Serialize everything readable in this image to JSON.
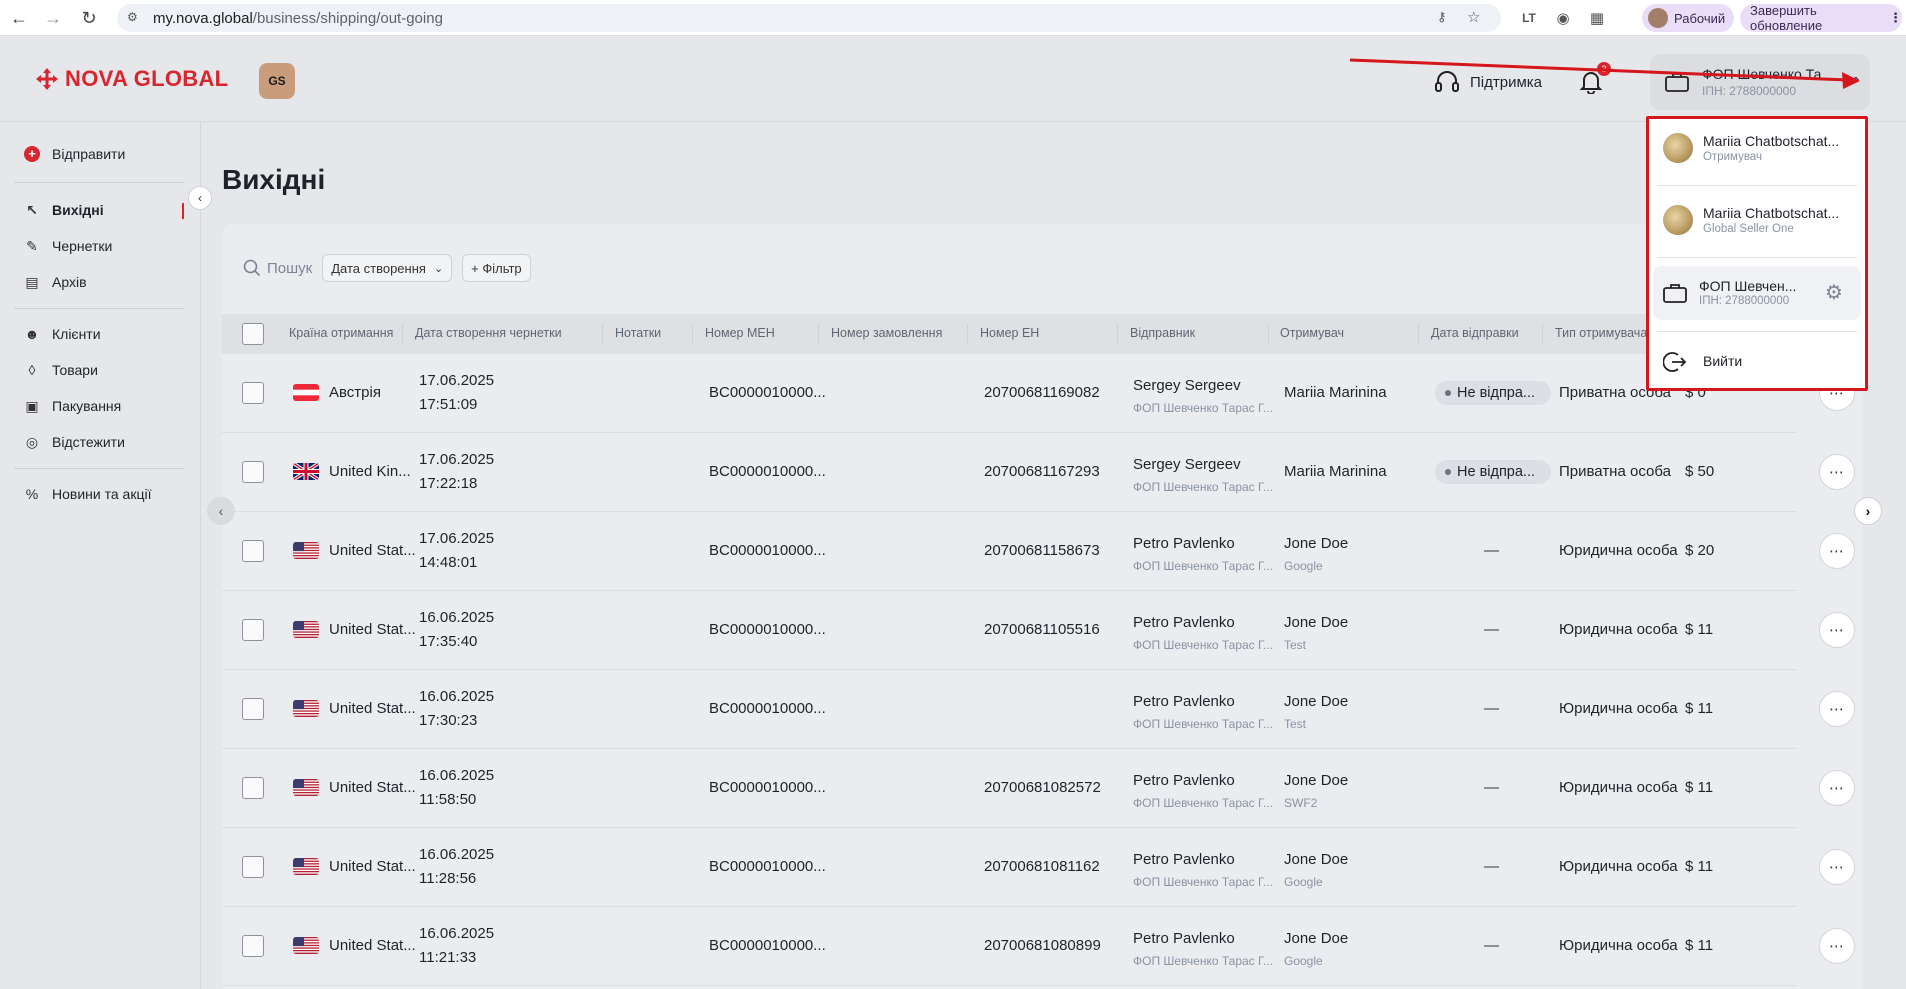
{
  "browser": {
    "url_host": "my.nova.global",
    "url_path": "/business/shipping/out-going",
    "profile_label": "Рабочий",
    "update_label": "Завершить обновление"
  },
  "header": {
    "logo_text": "NOVA GLOBAL",
    "badge_text": "GS",
    "support_label": "Підтримка",
    "notification_count": "2",
    "account_name": "ФОП Шевченко Та",
    "account_inn": "ІПН: 2788000000"
  },
  "sidebar": {
    "send_label": "Відправити",
    "items_group1": [
      {
        "label": "Вихідні",
        "icon": "arrow-up-left-icon"
      },
      {
        "label": "Чернетки",
        "icon": "edit-icon"
      },
      {
        "label": "Архів",
        "icon": "archive-icon"
      }
    ],
    "items_group2": [
      {
        "label": "Клієнти",
        "icon": "users-icon"
      },
      {
        "label": "Товари",
        "icon": "tag-icon"
      },
      {
        "label": "Пакування",
        "icon": "box-icon"
      },
      {
        "label": "Відстежити",
        "icon": "target-icon"
      }
    ],
    "items_group3": [
      {
        "label": "Новини та акції",
        "icon": "percent-icon"
      }
    ]
  },
  "page": {
    "title": "Вихідні",
    "search_placeholder": "Пошук",
    "date_select": "Дата створення",
    "filter_label": "+ Фільтр"
  },
  "table": {
    "headers": [
      "Країна отримання",
      "Дата створення чернетки",
      "Нотатки",
      "Номер МЕН",
      "Номер замовлення",
      "Номер ЕН",
      "Відправник",
      "Отримувач",
      "Дата відправки",
      "Тип отримувача"
    ],
    "rows": [
      {
        "flag": "at",
        "country": "Австрія",
        "date": "17.06.2025",
        "time": "17:51:09",
        "men": "BC0000010000...",
        "en": "20700681169082",
        "sender": "Sergey Sergeev",
        "sender_sub": "ФОП Шевченко Тарас Г...",
        "recipient": "Mariia Marinina",
        "recipient_sub": "",
        "status": "Не відпра...",
        "type": "Приватна особа",
        "amount": "$ 0"
      },
      {
        "flag": "gb",
        "country": "United Kin...",
        "date": "17.06.2025",
        "time": "17:22:18",
        "men": "BC0000010000...",
        "en": "20700681167293",
        "sender": "Sergey Sergeev",
        "sender_sub": "ФОП Шевченко Тарас Г...",
        "recipient": "Mariia Marinina",
        "recipient_sub": "",
        "status": "Не відпра...",
        "type": "Приватна особа",
        "amount": "$ 50"
      },
      {
        "flag": "us",
        "country": "United Stat...",
        "date": "17.06.2025",
        "time": "14:48:01",
        "men": "BC0000010000...",
        "en": "20700681158673",
        "sender": "Petro Pavlenko",
        "sender_sub": "ФОП Шевченко Тарас Г...",
        "recipient": "Jone Doe",
        "recipient_sub": "Google",
        "status": "—",
        "type": "Юридична особа",
        "amount": "$ 20"
      },
      {
        "flag": "us",
        "country": "United Stat...",
        "date": "16.06.2025",
        "time": "17:35:40",
        "men": "BC0000010000...",
        "en": "20700681105516",
        "sender": "Petro Pavlenko",
        "sender_sub": "ФОП Шевченко Тарас Г...",
        "recipient": "Jone Doe",
        "recipient_sub": "Test",
        "status": "—",
        "type": "Юридична особа",
        "amount": "$ 11"
      },
      {
        "flag": "us",
        "country": "United Stat...",
        "date": "16.06.2025",
        "time": "17:30:23",
        "men": "BC0000010000...",
        "en": "",
        "sender": "Petro Pavlenko",
        "sender_sub": "ФОП Шевченко Тарас Г...",
        "recipient": "Jone Doe",
        "recipient_sub": "Test",
        "status": "—",
        "type": "Юридична особа",
        "amount": "$ 11"
      },
      {
        "flag": "us",
        "country": "United Stat...",
        "date": "16.06.2025",
        "time": "11:58:50",
        "men": "BC0000010000...",
        "en": "20700681082572",
        "sender": "Petro Pavlenko",
        "sender_sub": "ФОП Шевченко Тарас Г...",
        "recipient": "Jone Doe",
        "recipient_sub": "SWF2",
        "status": "—",
        "type": "Юридична особа",
        "amount": "$ 11"
      },
      {
        "flag": "us",
        "country": "United Stat...",
        "date": "16.06.2025",
        "time": "11:28:56",
        "men": "BC0000010000...",
        "en": "20700681081162",
        "sender": "Petro Pavlenko",
        "sender_sub": "ФОП Шевченко Тарас Г...",
        "recipient": "Jone Doe",
        "recipient_sub": "Google",
        "status": "—",
        "type": "Юридична особа",
        "amount": "$ 11"
      },
      {
        "flag": "us",
        "country": "United Stat...",
        "date": "16.06.2025",
        "time": "11:21:33",
        "men": "BC0000010000...",
        "en": "20700681080899",
        "sender": "Petro Pavlenko",
        "sender_sub": "ФОП Шевченко Тарас Г...",
        "recipient": "Jone Doe",
        "recipient_sub": "Google",
        "status": "—",
        "type": "Юридична особа",
        "amount": "$ 11"
      }
    ]
  },
  "dropdown": {
    "accounts": [
      {
        "name": "Mariia Chatbotschat...",
        "role": "Отримувач"
      },
      {
        "name": "Mariia Chatbotschat...",
        "role": "Global Seller One"
      }
    ],
    "business": {
      "name": "ФОП Шевчен...",
      "inn": "ІПН: 2788000000"
    },
    "logout_label": "Вийти",
    "highlight_color": "#d5161d"
  }
}
